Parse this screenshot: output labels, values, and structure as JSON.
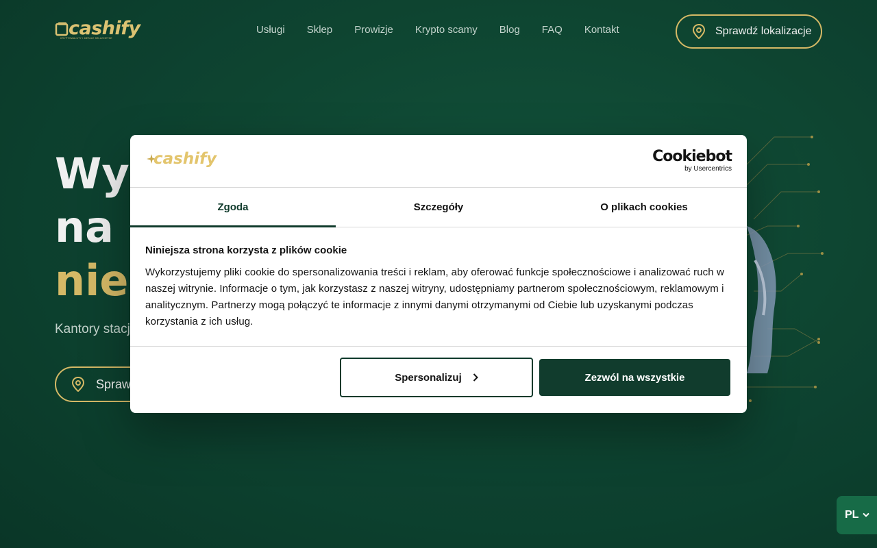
{
  "header": {
    "logo_text": "cashify",
    "logo_subtitle": "KRYPTOWALUTY I METALE SZLACHETNE",
    "nav": [
      "Usługi",
      "Sklep",
      "Prowizje",
      "Krypto scamy",
      "Blog",
      "FAQ",
      "Kontakt"
    ],
    "cta_label": "Sprawdź lokalizacje"
  },
  "hero": {
    "title_line1": "Wym",
    "title_line2": "na",
    "title_line3": "nier",
    "subtitle": "Kantory stacj",
    "cta_label": "Sprawd"
  },
  "cookie_dialog": {
    "logo_text": "cashify",
    "brand_name": "Cookiebot",
    "brand_by": "by Usercentrics",
    "tabs": [
      "Zgoda",
      "Szczegóły",
      "O plikach cookies"
    ],
    "active_tab": "Zgoda",
    "heading": "Niniejsza strona korzysta z plików cookie",
    "body": "Wykorzystujemy pliki cookie do spersonalizowania treści i reklam, aby oferować funkcje społecznościowe i analizować ruch w naszej witrynie. Informacje o tym, jak korzystasz z naszej witryny, udostępniamy partnerom społecznościowym, reklamowym i analitycznym. Partnerzy mogą połączyć te informacje z innymi danymi otrzymanymi od Ciebie lub uzyskanymi podczas korzystania z ich usług.",
    "customize_label": "Spersonalizuj",
    "allow_all_label": "Zezwól na wszystkie"
  },
  "language": {
    "current": "PL"
  },
  "colors": {
    "background": "#0f4a35",
    "accent_gold": "#e3c56d",
    "dialog_primary": "#113c2d",
    "lang_button": "#176b47"
  },
  "icons": {
    "pin": "location-pin-icon",
    "chevron_right": "chevron-right-icon",
    "chevron_down": "chevron-down-icon"
  }
}
